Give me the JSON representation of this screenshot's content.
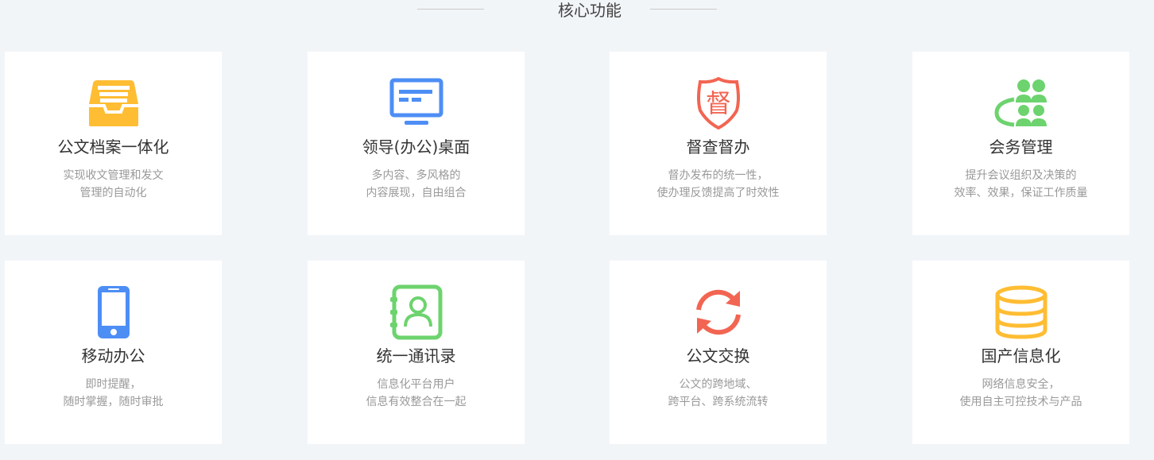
{
  "section_title": "核心功能",
  "features": [
    {
      "name": "公文档案一体化",
      "desc": [
        "实现收文管理和发文",
        "管理的自动化"
      ],
      "icon": "inbox-tray-icon",
      "color": "#ffbd33"
    },
    {
      "name": "领导(办公)桌面",
      "desc": [
        "多内容、多风格的",
        "内容展现，自由组合"
      ],
      "icon": "monitor-icon",
      "color": "#4d8ef5"
    },
    {
      "name": "督查督办",
      "desc": [
        "督办发布的统一性，",
        "使办理反馈提高了时效性"
      ],
      "icon": "supervision-shield-icon",
      "color": "#f26552",
      "glyph": "督"
    },
    {
      "name": "会务管理",
      "desc": [
        "提升会议组织及决策的",
        "效率、效果，保证工作质量"
      ],
      "icon": "meeting-group-icon",
      "color": "#6dd36e"
    },
    {
      "name": "移动办公",
      "desc": [
        "即时提醒，",
        "随时掌握，随时审批"
      ],
      "icon": "mobile-phone-icon",
      "color": "#4d8ef5"
    },
    {
      "name": "统一通讯录",
      "desc": [
        "信息化平台用户",
        "信息有效整合在一起"
      ],
      "icon": "address-book-icon",
      "color": "#6dd36e"
    },
    {
      "name": "公文交换",
      "desc": [
        "公文的跨地域、",
        "跨平台、跨系统流转"
      ],
      "icon": "exchange-arrows-icon",
      "color": "#f26552"
    },
    {
      "name": "国产信息化",
      "desc": [
        "网络信息安全，",
        "使用自主可控技术与产品"
      ],
      "icon": "database-icon",
      "color": "#ffbd33"
    }
  ]
}
